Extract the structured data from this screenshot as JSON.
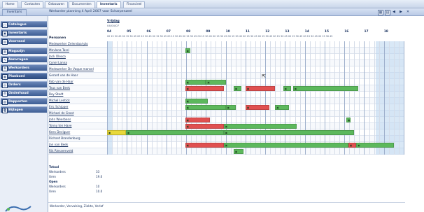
{
  "top_tabs": [
    {
      "label": "Home"
    },
    {
      "label": "Contacten"
    },
    {
      "label": "Gebouwen"
    },
    {
      "label": "Documenten"
    },
    {
      "label": "Inventaris"
    },
    {
      "label": "Financieel"
    }
  ],
  "breadcrumb": "Inventaris",
  "window_title": "Werkorder planning 4 April 2007 voor Scharpenzeel",
  "toolbar_icons": [
    "calendar-icon",
    "grid-icon",
    "back-icon",
    "forward-icon",
    "close-icon"
  ],
  "sidebar": [
    {
      "label": "Catalogus",
      "icon": "catalog-icon"
    },
    {
      "label": "Inventaris",
      "icon": "inventory-icon"
    },
    {
      "label": "Voorraad",
      "icon": "stock-icon"
    },
    {
      "label": "Magazijn",
      "icon": "warehouse-icon"
    },
    {
      "label": "Aanvragen",
      "icon": "requests-icon"
    },
    {
      "label": "Werkorders",
      "icon": "workorders-icon"
    },
    {
      "label": "Planbord",
      "icon": "planboard-icon"
    },
    {
      "label": "Orders",
      "icon": "orders-icon"
    },
    {
      "label": "Onderhoud",
      "icon": "maintenance-icon"
    },
    {
      "label": "Rapporten",
      "icon": "reports-icon"
    },
    {
      "label": "Bijlagen",
      "icon": "attachments-icon"
    }
  ],
  "day_header": {
    "label": "Vrijdag",
    "date": "04/04/07"
  },
  "hours": [
    "04",
    "05",
    "06",
    "07",
    "08",
    "09",
    "10",
    "11",
    "12",
    "13",
    "14",
    "15",
    "16",
    "17",
    "18"
  ],
  "quarter_labels": "00 15 30 45 00 15 30 45 00 15 30 45 00 15 30 45 00 15 30 45 00 15 30 45 00 15 30 45 00 15 30 45 00 15 30 45 00 15 30 45 00 15 30 45 00 15 30 45 00 15 30 45 00 15 30 45 00 15 30 45",
  "section_persons": "Personen",
  "persons": [
    {
      "name": "Medewerker Zelendaal-plo",
      "link": true
    },
    {
      "name": "Mevlana Tasci",
      "link": true
    },
    {
      "name": "Jack Olesco",
      "link": true
    },
    {
      "name": "Cynel Lanna",
      "link": true
    },
    {
      "name": "Medewerker De Vaque mansel",
      "link": true
    },
    {
      "name": "Gerard van de Haar",
      "link": false
    },
    {
      "name": "Rob van de Haar",
      "link": true
    },
    {
      "name": "Teus van Beek",
      "link": true
    },
    {
      "name": "Boy Stadt",
      "link": true
    },
    {
      "name": "Michel Lentick",
      "link": true
    },
    {
      "name": "Eric Schipper",
      "link": true
    },
    {
      "name": "Michael de Groot",
      "link": true
    },
    {
      "name": "John Weerbens",
      "link": true
    },
    {
      "name": "Tonny ten Have",
      "link": true
    },
    {
      "name": "Kees Deviguer",
      "link": true
    },
    {
      "name": "Richard Brandenburg",
      "link": false
    },
    {
      "name": "Jan van Beek",
      "link": true
    },
    {
      "name": "Rik Riessemveld",
      "link": true
    }
  ],
  "totals": {
    "title": "Totaal",
    "rows": [
      {
        "label": "Werkorders",
        "value": "33"
      },
      {
        "label": "Uren",
        "value": "19.0"
      }
    ],
    "open_title": "Open",
    "open_rows": [
      {
        "label": "Werkorders",
        "value": "10"
      },
      {
        "label": "Uren",
        "value": "10.0"
      }
    ]
  },
  "legend_footer": "Werkorder, Vervalsing, Ziekte, Verlof",
  "colors": {
    "planned": "#5cb85c",
    "late": "#e05050",
    "pending": "#e8d83a",
    "offhours": "#b9d6ef"
  }
}
